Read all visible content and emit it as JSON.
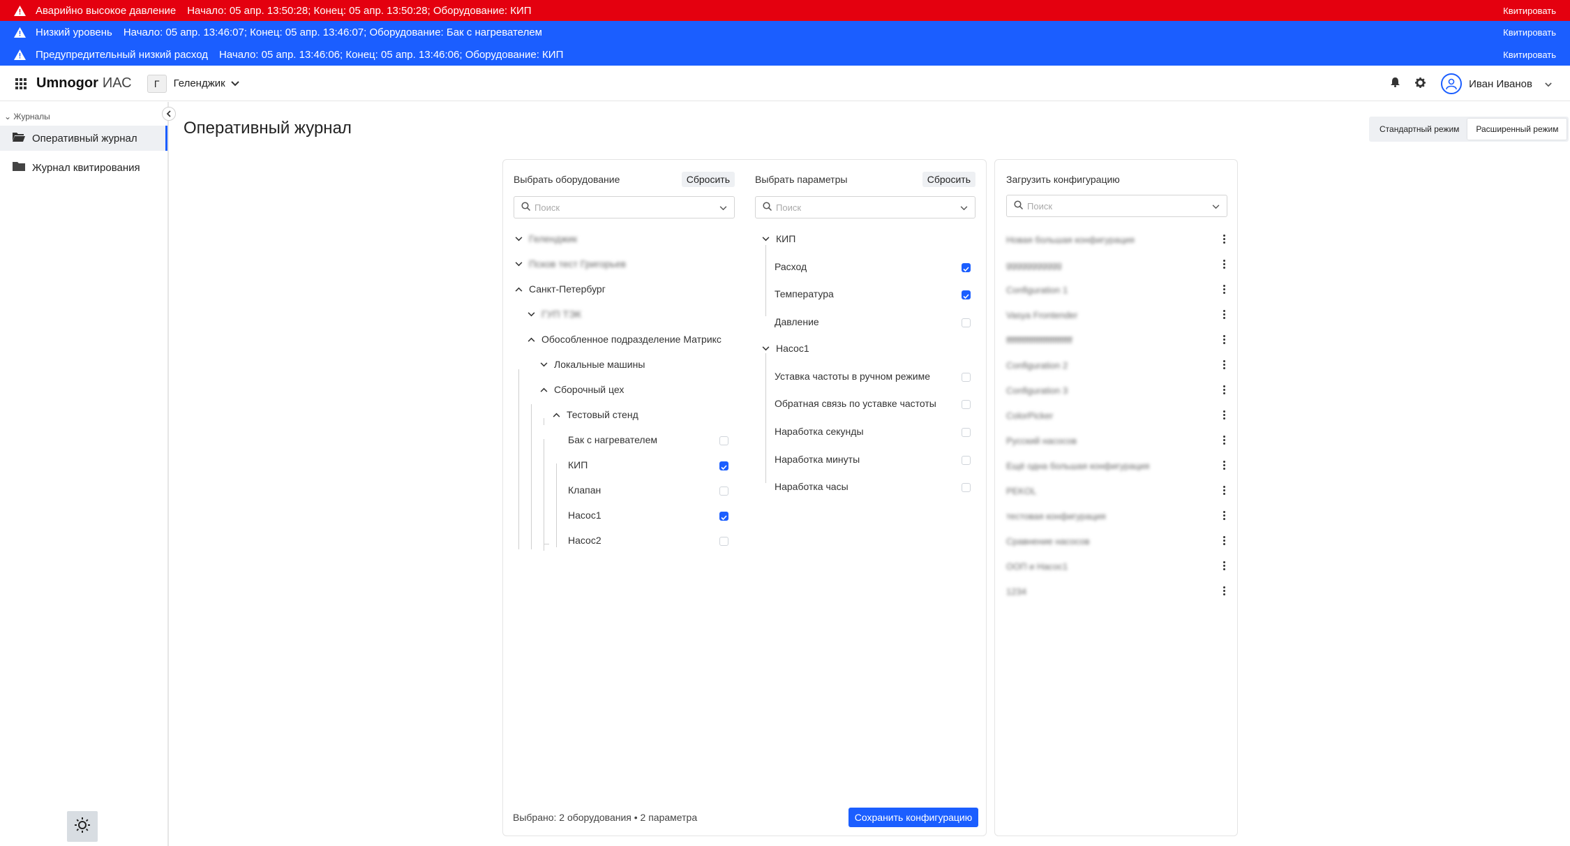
{
  "alerts": [
    {
      "title": "Аварийно высокое давление",
      "details": "Начало: 05 апр. 13:50:28; Конец: 05 апр. 13:50:28; Оборудование: КИП",
      "action": "Квитировать",
      "color": "#e4000f"
    },
    {
      "title": "Низкий уровень",
      "details": "Начало: 05 апр. 13:46:07; Конец: 05 апр. 13:46:07; Оборудование: Бак с нагревателем",
      "action": "Квитировать",
      "color": "#1b5eff"
    },
    {
      "title": "Предупредительный низкий расход",
      "details": "Начало: 05 апр. 13:46:06; Конец: 05 апр. 13:46:06; Оборудование: КИП",
      "action": "Квитировать",
      "color": "#1b5eff"
    }
  ],
  "header": {
    "logo_main": "Umnogor",
    "logo_sub": "ИАС",
    "city_badge": "Г",
    "city": "Геленджик",
    "user_name": "Иван Иванов"
  },
  "sidebar": {
    "section": "Журналы",
    "items": [
      {
        "label": "Оперативный журнал",
        "active": true
      },
      {
        "label": "Журнал квитирования",
        "active": false
      }
    ]
  },
  "page": {
    "title": "Оперативный журнал",
    "modes": [
      "Стандартный режим",
      "Расширенный режим"
    ],
    "active_mode": "Расширенный режим"
  },
  "equipment": {
    "label": "Выбрать оборудование",
    "reset": "Сбросить",
    "search_placeholder": "Поиск",
    "tree": [
      {
        "label": "Геленджик",
        "blurred": true
      },
      {
        "label": "Псков тест Григорьев",
        "blurred": true
      },
      {
        "label": "Санкт-Петербург",
        "blurred": false
      },
      {
        "label": "ГУП ТЭК",
        "blurred": true
      },
      {
        "label": "Обособленное подразделение Матрикс",
        "blurred": false
      },
      {
        "label": "Локальные машины",
        "blurred": false
      },
      {
        "label": "Сборочный цех",
        "blurred": false
      },
      {
        "label": "Тестовый стенд",
        "blurred": false
      },
      {
        "label": "Бак с нагревателем",
        "checked": false
      },
      {
        "label": "КИП",
        "checked": true
      },
      {
        "label": "Клапан",
        "checked": false
      },
      {
        "label": "Насос1",
        "checked": true
      },
      {
        "label": "Насос2",
        "checked": false
      }
    ],
    "summary": "Выбрано: 2 оборудования • 2 параметра"
  },
  "parameters": {
    "label": "Выбрать параметры",
    "reset": "Сбросить",
    "search_placeholder": "Поиск",
    "groups": [
      {
        "label": "КИП",
        "items": [
          {
            "label": "Расход",
            "checked": true
          },
          {
            "label": "Температура",
            "checked": true
          },
          {
            "label": "Давление",
            "checked": false
          }
        ]
      },
      {
        "label": "Насос1",
        "items": [
          {
            "label": "Уставка частоты в ручном режиме",
            "checked": false
          },
          {
            "label": "Обратная связь по уставке частоты",
            "checked": false
          },
          {
            "label": "Наработка секунды",
            "checked": false
          },
          {
            "label": "Наработка минуты",
            "checked": false
          },
          {
            "label": "Наработка часы",
            "checked": false
          }
        ]
      }
    ],
    "save": "Сохранить конфигурацию"
  },
  "configs": {
    "label": "Загрузить конфигурацию",
    "search_placeholder": "Поиск",
    "items": [
      "Новая большая конфигурация",
      "ggggggggggg",
      "Configuration 1",
      "Vasya Frontender",
      "ffffffffffffffffffffffffffff",
      "Configuration 2",
      "Configuration 3",
      "ColorPicker",
      "Русский насосов",
      "Ещё одна большая конфигурация",
      "PEKOL",
      "тестовая конфигурация",
      "Сравнение насосов",
      "ООП и Насос1",
      "1234"
    ]
  }
}
